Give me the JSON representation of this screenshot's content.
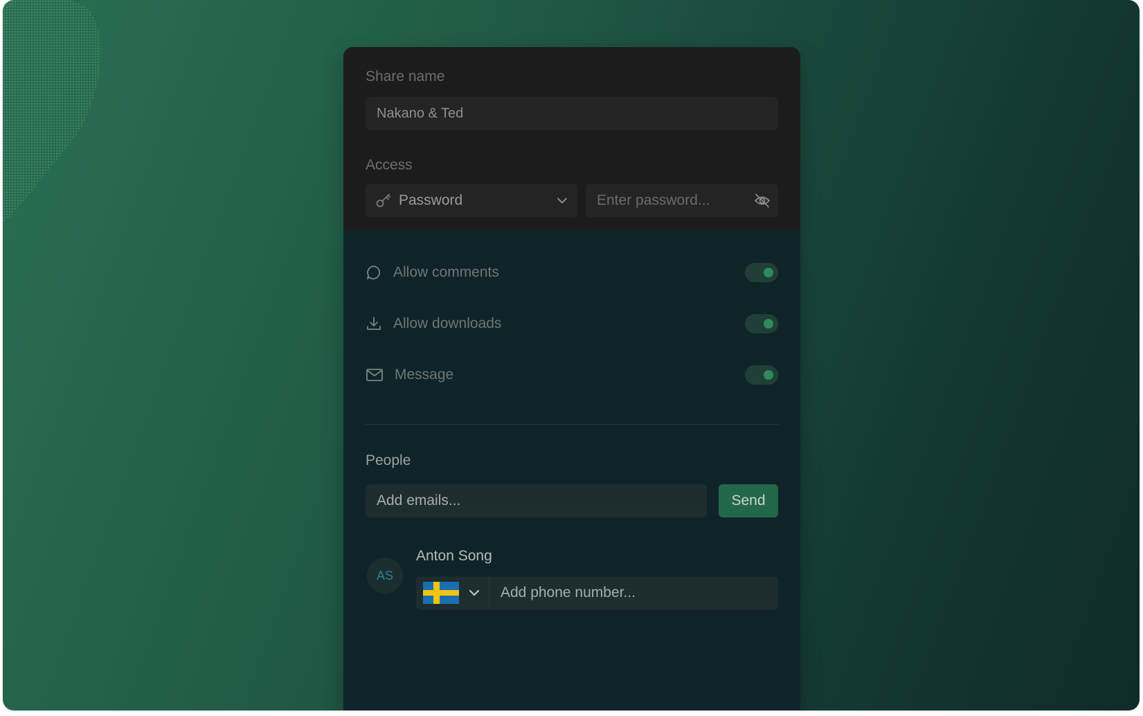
{
  "share_name": {
    "label": "Share name",
    "value": "Nakano & Ted"
  },
  "access": {
    "label": "Access",
    "type_selected": "Password",
    "password_placeholder": "Enter password..."
  },
  "settings": [
    {
      "label": "Allow comments",
      "icon": "comment-icon",
      "enabled": true
    },
    {
      "label": "Allow downloads",
      "icon": "download-icon",
      "enabled": true
    },
    {
      "label": "Message",
      "icon": "mail-icon",
      "enabled": true
    }
  ],
  "people": {
    "label": "People",
    "email_placeholder": "Add emails...",
    "send_label": "Send",
    "members": [
      {
        "initials": "AS",
        "name": "Anton Song",
        "country": "Sweden",
        "phone_placeholder": "Add phone number..."
      }
    ]
  },
  "colors": {
    "accent": "#24664a",
    "toggle_on": "#2f8a5b",
    "background_start": "#2a6e52",
    "background_end": "#0f2b2a"
  }
}
